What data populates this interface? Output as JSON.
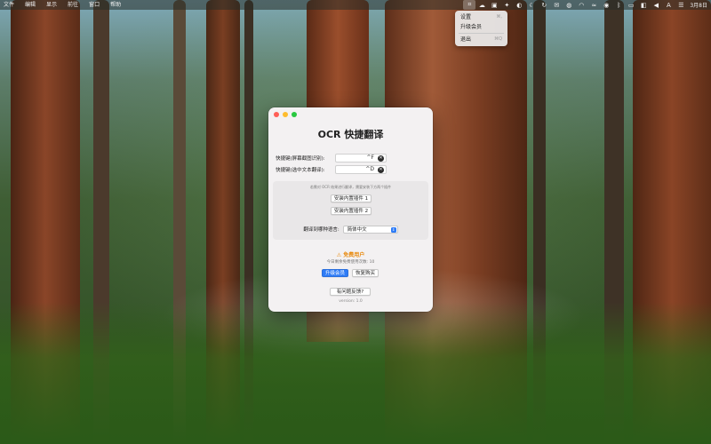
{
  "menubar": {
    "items": [
      "文件",
      "编辑",
      "显示",
      "前往",
      "窗口",
      "帮助"
    ],
    "clock": "3月8日",
    "status_icons": [
      "ocr-icon",
      "cloud-icon",
      "app-icon",
      "bird-icon",
      "drop-icon",
      "moon-icon",
      "circle-arrow-icon",
      "message-icon",
      "wechat-icon",
      "wifi-icon",
      "wave-icon",
      "cat-icon",
      "bluetooth-icon",
      "battery-icon",
      "toggle-icon",
      "volume-icon",
      "input-method-icon",
      "control-center-icon"
    ],
    "input_method_label": "A"
  },
  "dropdown": {
    "items": [
      {
        "label": "设置",
        "shortcut": "⌘,"
      },
      {
        "label": "升级会员",
        "shortcut": ""
      },
      {
        "label": "退出",
        "shortcut": "⌘Q"
      }
    ]
  },
  "window": {
    "title": "OCR 快捷翻译",
    "shortcuts": [
      {
        "label": "快捷键(屏幕截图识别):",
        "value": "^F"
      },
      {
        "label": "快捷键(选中文本翻译):",
        "value": "^D"
      }
    ],
    "plugin_note": "若需对 OCR 结果进行翻译，需要安装下方两个插件",
    "install_plugin_1": "安装内置插件 1",
    "install_plugin_2": "安装内置插件 2",
    "language_label": "翻译到哪种语言:",
    "language_value": "简体中文",
    "free_user": "⚠ 免费用户",
    "remaining": "今日剩余免费使用次数: 10",
    "upgrade": "升级会员",
    "restore": "恢复购买",
    "feedback": "有问题反馈?",
    "version": "version: 1.0"
  },
  "colors": {
    "accent": "#2f7cf6",
    "warning": "#e8890c"
  }
}
